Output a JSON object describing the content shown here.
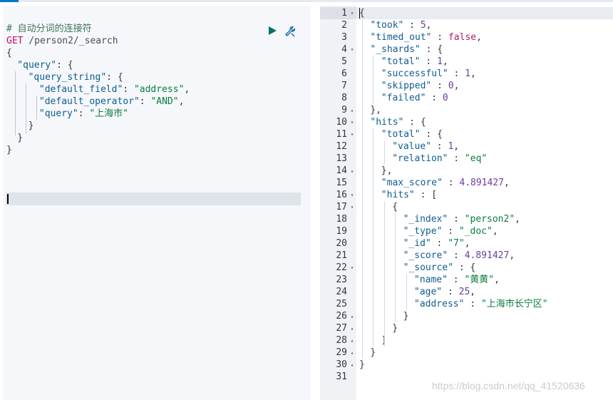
{
  "request": {
    "comment": "# 自动分词的连接符",
    "method": "GET",
    "path": " /person2/_search",
    "lines": [
      {
        "indent": 0,
        "tokens": [
          {
            "t": "{",
            "c": "punct"
          }
        ]
      },
      {
        "indent": 1,
        "tokens": [
          {
            "t": "\"query\"",
            "c": "key"
          },
          {
            "t": ": {",
            "c": "punct"
          }
        ]
      },
      {
        "indent": 2,
        "tokens": [
          {
            "t": "\"query_string\"",
            "c": "key"
          },
          {
            "t": ": {",
            "c": "punct"
          }
        ]
      },
      {
        "indent": 3,
        "tokens": [
          {
            "t": "\"default_field\"",
            "c": "key"
          },
          {
            "t": ": ",
            "c": "punct"
          },
          {
            "t": "\"address\"",
            "c": "str"
          },
          {
            "t": ",",
            "c": "punct"
          }
        ]
      },
      {
        "indent": 3,
        "tokens": [
          {
            "t": "\"default_operator\"",
            "c": "key"
          },
          {
            "t": ": ",
            "c": "punct"
          },
          {
            "t": "\"AND\"",
            "c": "str"
          },
          {
            "t": ",",
            "c": "punct"
          }
        ]
      },
      {
        "indent": 3,
        "tokens": [
          {
            "t": "\"query\"",
            "c": "key"
          },
          {
            "t": ": ",
            "c": "punct"
          },
          {
            "t": "\"上海市\"",
            "c": "str"
          }
        ]
      },
      {
        "indent": 2,
        "tokens": [
          {
            "t": "}",
            "c": "punct"
          }
        ]
      },
      {
        "indent": 1,
        "tokens": [
          {
            "t": "}",
            "c": "punct"
          }
        ]
      },
      {
        "indent": 0,
        "tokens": [
          {
            "t": "}",
            "c": "punct"
          }
        ]
      }
    ],
    "run_icon": "play-icon",
    "wrench_icon": "wrench-icon"
  },
  "response": {
    "lines": [
      {
        "n": "1",
        "fold": "▾",
        "indent": 0,
        "tokens": [
          {
            "t": "{",
            "c": "punct"
          }
        ]
      },
      {
        "n": "2",
        "fold": "",
        "indent": 1,
        "tokens": [
          {
            "t": "\"took\"",
            "c": "key"
          },
          {
            "t": " : ",
            "c": "punct"
          },
          {
            "t": "5",
            "c": "num"
          },
          {
            "t": ",",
            "c": "punct"
          }
        ]
      },
      {
        "n": "3",
        "fold": "",
        "indent": 1,
        "tokens": [
          {
            "t": "\"timed_out\"",
            "c": "key"
          },
          {
            "t": " : ",
            "c": "punct"
          },
          {
            "t": "false",
            "c": "bool"
          },
          {
            "t": ",",
            "c": "punct"
          }
        ]
      },
      {
        "n": "4",
        "fold": "▾",
        "indent": 1,
        "tokens": [
          {
            "t": "\"_shards\"",
            "c": "key"
          },
          {
            "t": " : {",
            "c": "punct"
          }
        ]
      },
      {
        "n": "5",
        "fold": "",
        "indent": 2,
        "tokens": [
          {
            "t": "\"total\"",
            "c": "key"
          },
          {
            "t": " : ",
            "c": "punct"
          },
          {
            "t": "1",
            "c": "num"
          },
          {
            "t": ",",
            "c": "punct"
          }
        ]
      },
      {
        "n": "6",
        "fold": "",
        "indent": 2,
        "tokens": [
          {
            "t": "\"successful\"",
            "c": "key"
          },
          {
            "t": " : ",
            "c": "punct"
          },
          {
            "t": "1",
            "c": "num"
          },
          {
            "t": ",",
            "c": "punct"
          }
        ]
      },
      {
        "n": "7",
        "fold": "",
        "indent": 2,
        "tokens": [
          {
            "t": "\"skipped\"",
            "c": "key"
          },
          {
            "t": " : ",
            "c": "punct"
          },
          {
            "t": "0",
            "c": "num"
          },
          {
            "t": ",",
            "c": "punct"
          }
        ]
      },
      {
        "n": "8",
        "fold": "",
        "indent": 2,
        "tokens": [
          {
            "t": "\"failed\"",
            "c": "key"
          },
          {
            "t": " : ",
            "c": "punct"
          },
          {
            "t": "0",
            "c": "num"
          }
        ]
      },
      {
        "n": "9",
        "fold": "▴",
        "indent": 1,
        "tokens": [
          {
            "t": "},",
            "c": "punct"
          }
        ]
      },
      {
        "n": "10",
        "fold": "▾",
        "indent": 1,
        "tokens": [
          {
            "t": "\"hits\"",
            "c": "key"
          },
          {
            "t": " : {",
            "c": "punct"
          }
        ]
      },
      {
        "n": "11",
        "fold": "▾",
        "indent": 2,
        "tokens": [
          {
            "t": "\"total\"",
            "c": "key"
          },
          {
            "t": " : {",
            "c": "punct"
          }
        ]
      },
      {
        "n": "12",
        "fold": "",
        "indent": 3,
        "tokens": [
          {
            "t": "\"value\"",
            "c": "key"
          },
          {
            "t": " : ",
            "c": "punct"
          },
          {
            "t": "1",
            "c": "num"
          },
          {
            "t": ",",
            "c": "punct"
          }
        ]
      },
      {
        "n": "13",
        "fold": "",
        "indent": 3,
        "tokens": [
          {
            "t": "\"relation\"",
            "c": "key"
          },
          {
            "t": " : ",
            "c": "punct"
          },
          {
            "t": "\"eq\"",
            "c": "str"
          }
        ]
      },
      {
        "n": "14",
        "fold": "▴",
        "indent": 2,
        "tokens": [
          {
            "t": "},",
            "c": "punct"
          }
        ]
      },
      {
        "n": "15",
        "fold": "",
        "indent": 2,
        "tokens": [
          {
            "t": "\"max_score\"",
            "c": "key"
          },
          {
            "t": " : ",
            "c": "punct"
          },
          {
            "t": "4.891427",
            "c": "num"
          },
          {
            "t": ",",
            "c": "punct"
          }
        ]
      },
      {
        "n": "16",
        "fold": "▾",
        "indent": 2,
        "tokens": [
          {
            "t": "\"hits\"",
            "c": "key"
          },
          {
            "t": " : [",
            "c": "punct"
          }
        ]
      },
      {
        "n": "17",
        "fold": "▾",
        "indent": 3,
        "tokens": [
          {
            "t": "{",
            "c": "punct"
          }
        ]
      },
      {
        "n": "18",
        "fold": "",
        "indent": 4,
        "tokens": [
          {
            "t": "\"_index\"",
            "c": "key"
          },
          {
            "t": " : ",
            "c": "punct"
          },
          {
            "t": "\"person2\"",
            "c": "str"
          },
          {
            "t": ",",
            "c": "punct"
          }
        ]
      },
      {
        "n": "19",
        "fold": "",
        "indent": 4,
        "tokens": [
          {
            "t": "\"_type\"",
            "c": "key"
          },
          {
            "t": " : ",
            "c": "punct"
          },
          {
            "t": "\"_doc\"",
            "c": "str"
          },
          {
            "t": ",",
            "c": "punct"
          }
        ]
      },
      {
        "n": "20",
        "fold": "",
        "indent": 4,
        "tokens": [
          {
            "t": "\"_id\"",
            "c": "key"
          },
          {
            "t": " : ",
            "c": "punct"
          },
          {
            "t": "\"7\"",
            "c": "str"
          },
          {
            "t": ",",
            "c": "punct"
          }
        ]
      },
      {
        "n": "21",
        "fold": "",
        "indent": 4,
        "tokens": [
          {
            "t": "\"_score\"",
            "c": "key"
          },
          {
            "t": " : ",
            "c": "punct"
          },
          {
            "t": "4.891427",
            "c": "num"
          },
          {
            "t": ",",
            "c": "punct"
          }
        ]
      },
      {
        "n": "22",
        "fold": "▾",
        "indent": 4,
        "tokens": [
          {
            "t": "\"_source\"",
            "c": "key"
          },
          {
            "t": " : {",
            "c": "punct"
          }
        ]
      },
      {
        "n": "23",
        "fold": "",
        "indent": 5,
        "tokens": [
          {
            "t": "\"name\"",
            "c": "key"
          },
          {
            "t": " : ",
            "c": "punct"
          },
          {
            "t": "\"黄黄\"",
            "c": "str"
          },
          {
            "t": ",",
            "c": "punct"
          }
        ]
      },
      {
        "n": "24",
        "fold": "",
        "indent": 5,
        "tokens": [
          {
            "t": "\"age\"",
            "c": "key"
          },
          {
            "t": " : ",
            "c": "punct"
          },
          {
            "t": "25",
            "c": "num"
          },
          {
            "t": ",",
            "c": "punct"
          }
        ]
      },
      {
        "n": "25",
        "fold": "",
        "indent": 5,
        "tokens": [
          {
            "t": "\"address\"",
            "c": "key"
          },
          {
            "t": " : ",
            "c": "punct"
          },
          {
            "t": "\"上海市长宁区\"",
            "c": "str"
          }
        ]
      },
      {
        "n": "26",
        "fold": "▴",
        "indent": 4,
        "tokens": [
          {
            "t": "}",
            "c": "punct"
          }
        ]
      },
      {
        "n": "27",
        "fold": "▴",
        "indent": 3,
        "tokens": [
          {
            "t": "}",
            "c": "punct"
          }
        ]
      },
      {
        "n": "28",
        "fold": "▴",
        "indent": 2,
        "tokens": [
          {
            "t": "]",
            "c": "punct"
          }
        ]
      },
      {
        "n": "29",
        "fold": "▴",
        "indent": 1,
        "tokens": [
          {
            "t": "}",
            "c": "punct"
          }
        ]
      },
      {
        "n": "30",
        "fold": "▴",
        "indent": 0,
        "tokens": [
          {
            "t": "}",
            "c": "punct"
          }
        ]
      },
      {
        "n": "31",
        "fold": "",
        "indent": 0,
        "tokens": []
      }
    ]
  },
  "watermark": "https://blog.csdn.net/qq_41520636",
  "colors": {
    "accent": "#0077cc",
    "run_button": "#00726b",
    "wrench": "#0061a6",
    "string": "#0b7d40",
    "key": "#0f5d8f"
  }
}
